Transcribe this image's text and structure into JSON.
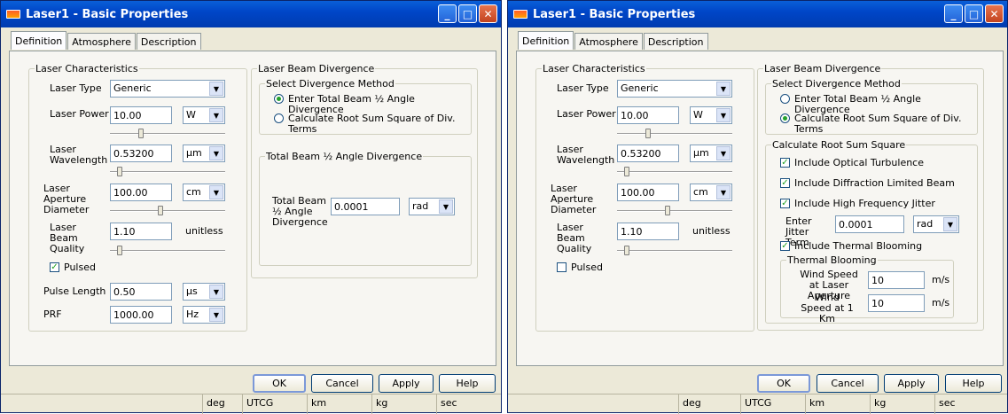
{
  "window_title": "Laser1 - Basic Properties",
  "tabs": [
    "Definition",
    "Atmosphere",
    "Description"
  ],
  "buttons": {
    "ok": "OK",
    "cancel": "Cancel",
    "apply": "Apply",
    "help": "Help"
  },
  "status": [
    "deg",
    "UTCG",
    "km",
    "kg",
    "sec"
  ],
  "labels": {
    "laser_characteristics": "Laser Characteristics",
    "laser_type": "Laser Type",
    "laser_power": "Laser Power",
    "laser_wavelength": "Laser Wavelength",
    "laser_aperture_diameter": "Laser Aperture Diameter",
    "laser_beam_quality": "Laser Beam Quality",
    "unitless": "unitless",
    "pulsed": "Pulsed",
    "pulse_length": "Pulse Length",
    "prf": "PRF",
    "laser_beam_divergence": "Laser Beam Divergence",
    "select_divergence_method": "Select Divergence Method",
    "enter_total": "Enter Total Beam ½ Angle Divergence",
    "calc_rss": "Calculate Root Sum Square of Div. Terms",
    "total_beam_group": "Total Beam ½ Angle Divergence",
    "total_beam_field": "Total Beam ½ Angle Divergence",
    "calc_rss_group": "Calculate Root Sum Square",
    "optical_turbulence": "Include Optical Turbulence",
    "diffraction_limited": "Include Diffraction Limited Beam",
    "high_freq_jitter": "Include High Frequency Jitter",
    "enter_jitter_term": "Enter Jitter Term",
    "thermal_blooming_chk": "Include Thermal Blooming",
    "thermal_blooming_group": "Thermal Blooming",
    "wind_speed_aperture": "Wind Speed at Laser Aperture",
    "wind_speed_1km": "Wind Speed at 1 Km",
    "ms": "m/s"
  },
  "values": {
    "laser_type": "Generic",
    "laser_power": "10.00",
    "laser_power_unit": "W",
    "wavelength": "0.53200",
    "wavelength_unit": "µm",
    "aperture": "100.00",
    "aperture_unit": "cm",
    "beam_quality": "1.10",
    "pulse_length": "0.50",
    "pulse_length_unit": "µs",
    "prf": "1000.00",
    "prf_unit": "Hz",
    "divergence": "0.0001",
    "divergence_unit": "rad",
    "jitter": "0.0001",
    "jitter_unit": "rad",
    "wind_aperture": "10",
    "wind_1km": "10"
  }
}
